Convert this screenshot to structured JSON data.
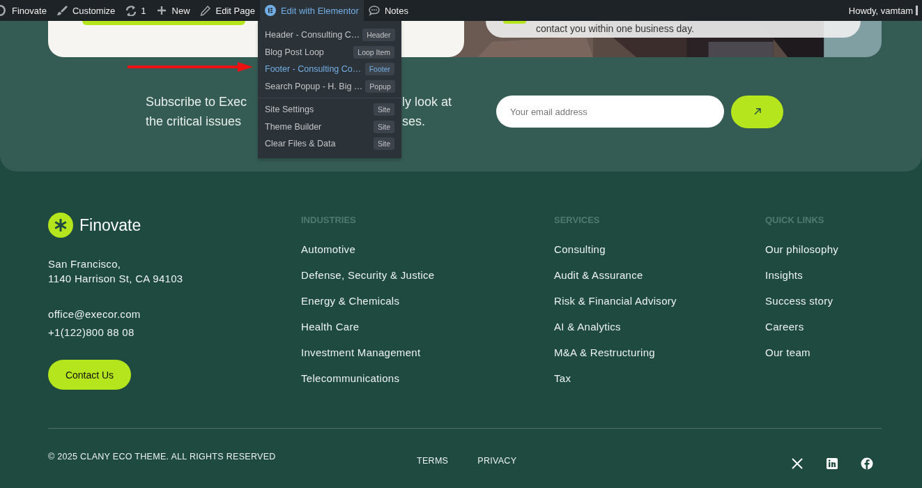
{
  "admin_bar": {
    "site": "Finovate",
    "items": [
      {
        "kind": "customize",
        "label": "Customize",
        "selected": false
      },
      {
        "kind": "updates",
        "label": "1",
        "selected": false
      },
      {
        "kind": "new",
        "label": "New",
        "selected": false
      },
      {
        "kind": "edit",
        "label": "Edit Page",
        "selected": false
      },
      {
        "kind": "elementor",
        "label": "Edit with Elementor",
        "selected": true
      },
      {
        "kind": "notes",
        "label": "Notes",
        "selected": false
      }
    ],
    "user": "Howdy, vamtam"
  },
  "elementor_menu": {
    "sections": [
      {
        "items": [
          {
            "label": "Header - Consulting C…",
            "tag": "Header",
            "selected": false
          },
          {
            "label": "Blog Post Loop",
            "tag": "Loop Item",
            "selected": false
          },
          {
            "label": "Footer - Consulting Co…",
            "tag": "Footer",
            "selected": true
          },
          {
            "label": "Search Popup - H. Big …",
            "tag": "Popup",
            "selected": false
          }
        ]
      },
      {
        "items": [
          {
            "label": "Site Settings",
            "tag": "Site",
            "selected": false
          },
          {
            "label": "Theme Builder",
            "tag": "Site",
            "selected": false
          },
          {
            "label": "Clear Files & Data",
            "tag": "Site",
            "selected": false
          }
        ]
      }
    ]
  },
  "hero": {
    "card_text": "contact you within one business day."
  },
  "subscribe": {
    "lines": [
      [
        "Subscribe to Exec",
        "ly look at"
      ],
      [
        "the critical issues",
        "ses."
      ]
    ],
    "email_placeholder": "Your email address"
  },
  "footer": {
    "brand": "Finovate",
    "address_lines": [
      "San Francisco,",
      "1140 Harrison St, CA 94103"
    ],
    "email": "office@execor.com",
    "phone": "+1(122)800 88 08",
    "contact_button": "Contact Us",
    "columns": [
      {
        "heading": "INDUSTRIES",
        "links": [
          "Automotive",
          "Defense, Security & Justice",
          "Energy & Chemicals",
          "Health Care",
          "Investment Management",
          "Telecommunications"
        ]
      },
      {
        "heading": "SERVICES",
        "links": [
          "Consulting",
          "Audit & Assurance",
          "Risk & Financial Advisory",
          "AI & Analytics",
          "M&A & Restructuring",
          "Tax"
        ]
      },
      {
        "heading": "QUICK LINKS",
        "links": [
          "Our philosophy",
          "Insights",
          "Success story",
          "Careers",
          "Our team"
        ]
      }
    ],
    "copyright": "© 2025 CLANY ECO THEME. ALL RIGHTS RESERVED",
    "legal_links": [
      "TERMS",
      "PRIVACY"
    ],
    "social": [
      {
        "kind": "x"
      },
      {
        "kind": "linkedin"
      },
      {
        "kind": "facebook"
      }
    ]
  }
}
